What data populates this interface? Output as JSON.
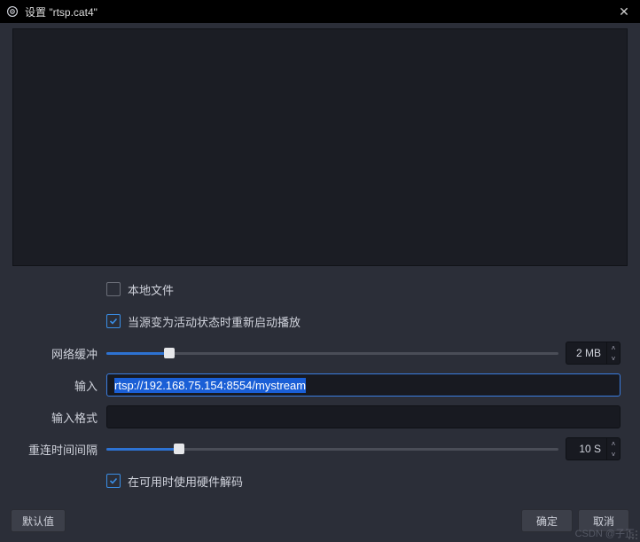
{
  "titlebar": {
    "title": "设置 \"rtsp.cat4\""
  },
  "checkbox_local": {
    "label": "本地文件",
    "checked": false
  },
  "checkbox_restart": {
    "label": "当源变为活动状态时重新启动播放",
    "checked": true
  },
  "checkbox_hw": {
    "label": "在可用时使用硬件解码",
    "checked": true
  },
  "labels": {
    "buffer": "网络缓冲",
    "input": "输入",
    "format": "输入格式",
    "reconnect": "重连时间间隔"
  },
  "buffer": {
    "value_label": "2 MB",
    "fill_pct": 14
  },
  "input": {
    "value": "rtsp://192.168.75.154:8554/mystream"
  },
  "format": {
    "value": ""
  },
  "reconnect": {
    "value_label": "10 S",
    "fill_pct": 16
  },
  "buttons": {
    "defaults": "默认值",
    "ok": "确定",
    "cancel": "取消"
  },
  "watermark": "CSDN @子正"
}
